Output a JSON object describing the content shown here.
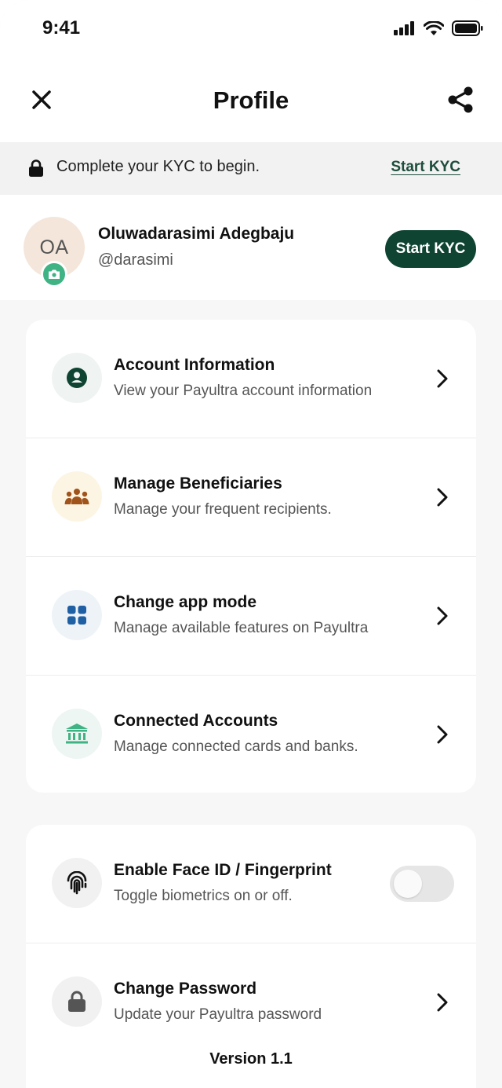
{
  "status_bar": {
    "time": "9:41",
    "icons": [
      "signal-icon",
      "wifi-icon",
      "battery-icon"
    ]
  },
  "header": {
    "title": "Profile",
    "close_icon": "close-icon",
    "share_icon": "share-icon"
  },
  "kyc_banner": {
    "text": "Complete your KYC to begin.",
    "link": "Start KYC",
    "icon": "lock-icon"
  },
  "profile": {
    "initials": "OA",
    "name": "Oluwadarasimi Adegbaju",
    "handle": "@darasimi",
    "kyc_button": "Start KYC",
    "camera_icon": "camera-icon"
  },
  "menu": [
    {
      "title": "Account Information",
      "subtitle": "View your Payultra account information",
      "icon": "user-circle-icon"
    },
    {
      "title": "Manage Beneficiaries",
      "subtitle": "Manage your frequent recipients.",
      "icon": "group-icon"
    },
    {
      "title": "Change app mode",
      "subtitle": "Manage available features on Payultra",
      "icon": "grid-icon"
    },
    {
      "title": "Connected Accounts",
      "subtitle": "Manage connected cards and banks.",
      "icon": "bank-icon"
    }
  ],
  "security": [
    {
      "title": "Enable Face ID / Fingerprint",
      "subtitle": "Toggle biometrics on or off.",
      "icon": "fingerprint-icon",
      "toggle_on": false
    },
    {
      "title": "Change Password",
      "subtitle": "Update your Payultra password",
      "icon": "lock-icon"
    }
  ],
  "footer": {
    "version": "Version 1.1"
  },
  "colors": {
    "brand_dark_green": "#0e4431",
    "accent_green": "#3fb383",
    "avatar_bg": "#f4e6db"
  }
}
